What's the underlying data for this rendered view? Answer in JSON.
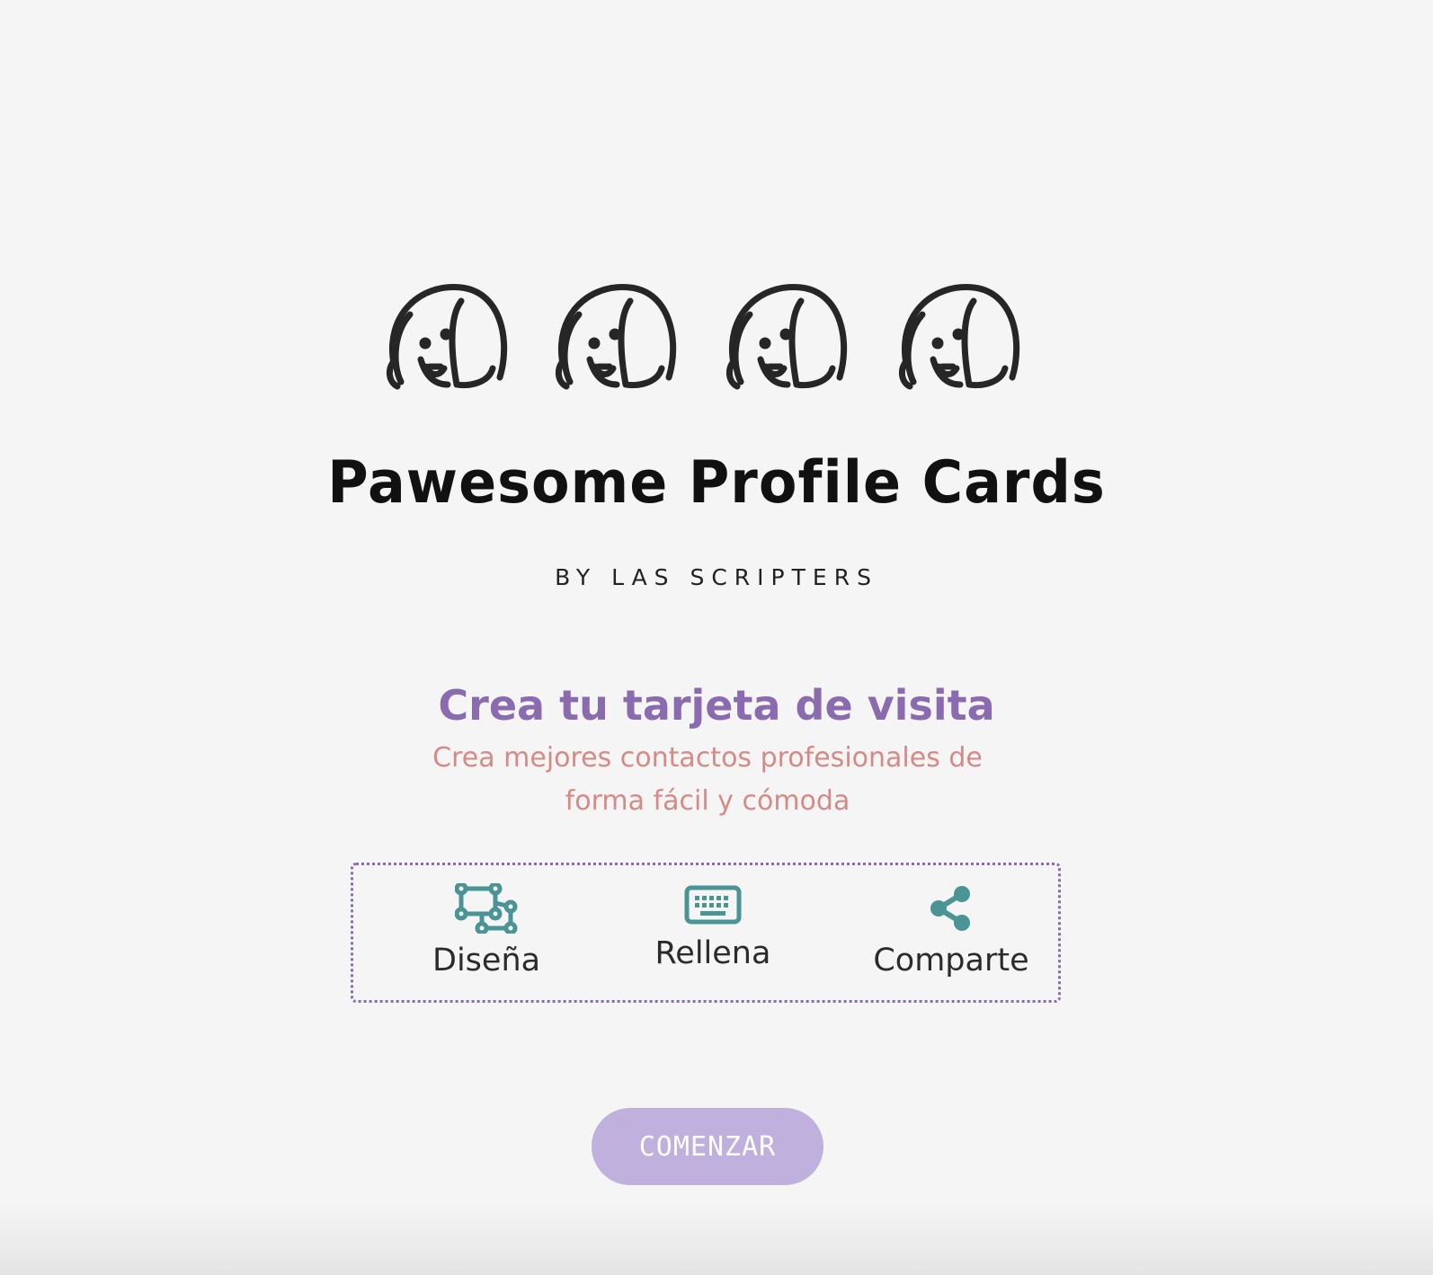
{
  "logo": {
    "title": "Pawesome Profile Cards",
    "byline": "BY LAS SCRIPTERS",
    "icons": [
      "dog-face-icon",
      "dog-face-icon",
      "dog-face-icon",
      "dog-face-icon"
    ]
  },
  "hero": {
    "headline": "Crea tu tarjeta de visita",
    "subhead": "Crea mejores contactos profesionales de forma fácil y cómoda"
  },
  "steps": [
    {
      "label": "Diseña",
      "icon": "design-shapes-icon"
    },
    {
      "label": "Rellena",
      "icon": "keyboard-icon"
    },
    {
      "label": "Comparte",
      "icon": "share-icon"
    }
  ],
  "cta": {
    "label": "COMENZAR"
  },
  "colors": {
    "background": "#f5f5f5",
    "headline": "#8a6bb0",
    "subhead": "#d68a86",
    "icon": "#4a9496",
    "button": "#bfb0dd",
    "border": "#8a6bb0"
  }
}
